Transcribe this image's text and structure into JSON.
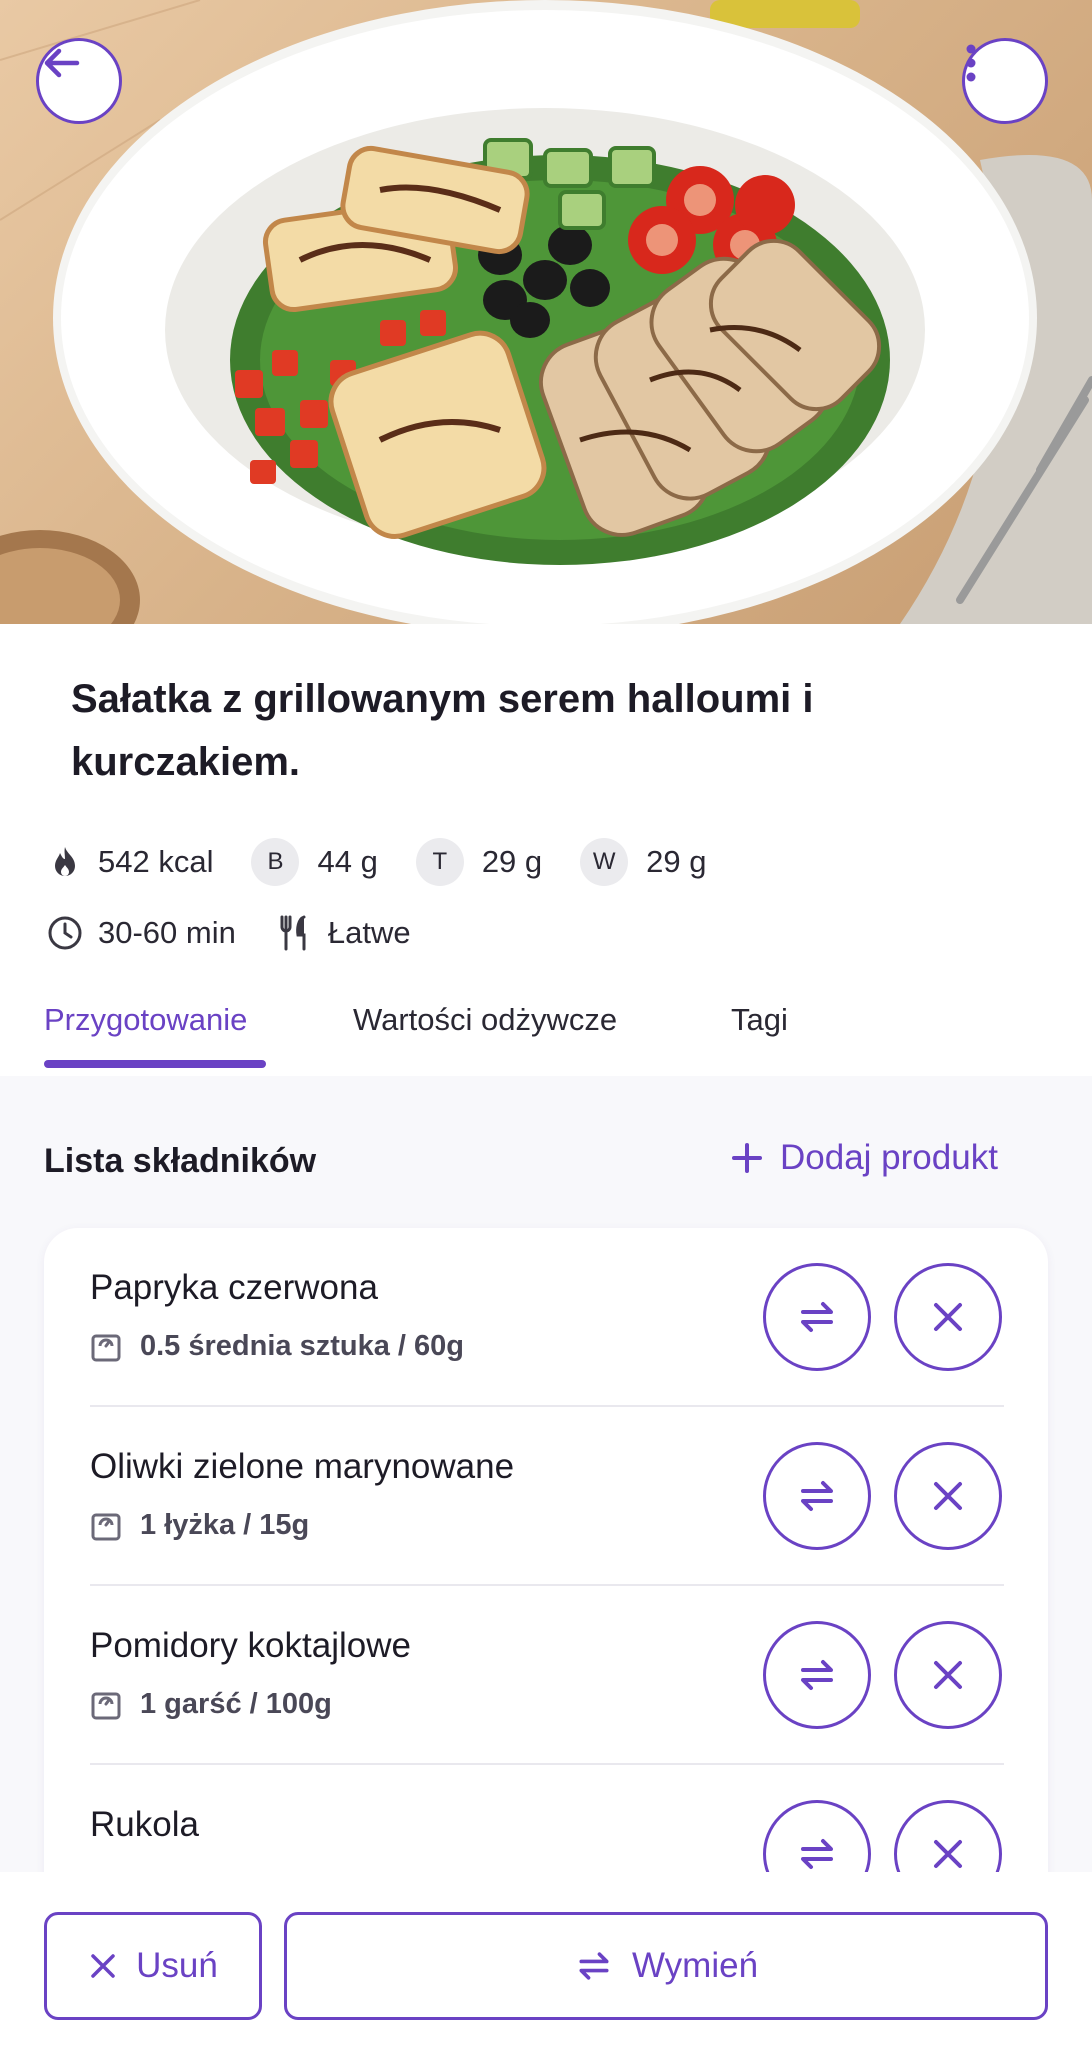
{
  "hero": {
    "image": "salad-photo",
    "back_icon": "arrow-left-icon",
    "menu_icon": "more-vertical-icon"
  },
  "recipe": {
    "title": "Sałatka z grillowanym serem halloumi i kurczakiem."
  },
  "nutrition": {
    "kcal": "542 kcal",
    "protein_badge": "B",
    "protein": "44 g",
    "fat_badge": "T",
    "fat": "29 g",
    "carbs_badge": "W",
    "carbs": "29 g"
  },
  "details": {
    "time": "30-60 min",
    "difficulty": "Łatwe"
  },
  "tabs": [
    {
      "label": "Przygotowanie",
      "active": true
    },
    {
      "label": "Wartości odżywcze",
      "active": false
    },
    {
      "label": "Tagi",
      "active": false
    }
  ],
  "ingredients_section": {
    "title": "Lista składników",
    "add_label": "Dodaj produkt"
  },
  "ingredients": [
    {
      "name": "Papryka czerwona",
      "amount": "0.5 średnia sztuka / 60g"
    },
    {
      "name": "Oliwki zielone marynowane",
      "amount": "1 łyżka / 15g"
    },
    {
      "name": "Pomidory koktajlowe",
      "amount": "1 garść / 100g"
    },
    {
      "name": "Rukola",
      "amount": ""
    }
  ],
  "actions": {
    "delete_label": "Usuń",
    "swap_label": "Wymień"
  },
  "colors": {
    "accent": "#6a42c4",
    "background_section": "#f8f8fb",
    "badge_bg": "#ebebee"
  }
}
